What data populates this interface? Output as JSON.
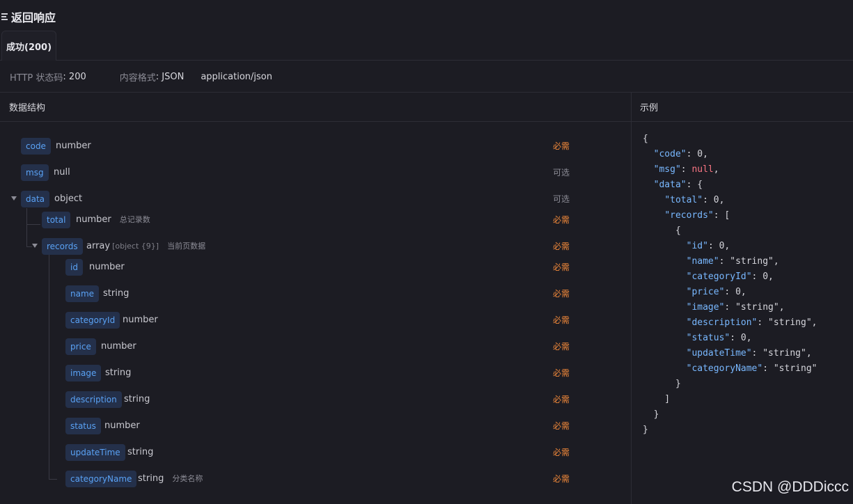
{
  "header": {
    "title": "返回响应"
  },
  "tabs": [
    {
      "label": "成功(200)"
    }
  ],
  "meta": {
    "status_label": "HTTP 状态码",
    "status_value": "200",
    "format_label": "内容格式",
    "format_value": "JSON",
    "mime": "application/json"
  },
  "schema_panel": {
    "title": "数据结构"
  },
  "example_panel": {
    "title": "示例"
  },
  "fields": {
    "code": {
      "name": "code",
      "type": "number",
      "required": "必需"
    },
    "msg": {
      "name": "msg",
      "type": "null",
      "required": "可选"
    },
    "data": {
      "name": "data",
      "type": "object",
      "required": "可选"
    },
    "total": {
      "name": "total",
      "type": "number",
      "desc": "总记录数",
      "required": "必需"
    },
    "records": {
      "name": "records",
      "type": "array",
      "subtype": "[object {9}]",
      "desc": "当前页数据",
      "required": "必需"
    },
    "id": {
      "name": "id",
      "type": "number",
      "required": "必需"
    },
    "rname": {
      "name": "name",
      "type": "string",
      "required": "必需"
    },
    "categoryId": {
      "name": "categoryId",
      "type": "number",
      "required": "必需"
    },
    "price": {
      "name": "price",
      "type": "number",
      "required": "必需"
    },
    "image": {
      "name": "image",
      "type": "string",
      "required": "必需"
    },
    "description": {
      "name": "description",
      "type": "string",
      "required": "必需"
    },
    "status": {
      "name": "status",
      "type": "number",
      "required": "必需"
    },
    "updateTime": {
      "name": "updateTime",
      "type": "string",
      "required": "必需"
    },
    "categoryName": {
      "name": "categoryName",
      "type": "string",
      "desc": "分类名称",
      "required": "必需"
    }
  },
  "example_lines": [
    "{",
    "  \"code\": 0,",
    "  \"msg\": null,",
    "  \"data\": {",
    "    \"total\": 0,",
    "    \"records\": [",
    "      {",
    "        \"id\": 0,",
    "        \"name\": \"string\",",
    "        \"categoryId\": 0,",
    "        \"price\": 0,",
    "        \"image\": \"string\",",
    "        \"description\": \"string\",",
    "        \"status\": 0,",
    "        \"updateTime\": \"string\",",
    "        \"categoryName\": \"string\"",
    "      }",
    "    ]",
    "  }",
    "}"
  ],
  "watermark": "CSDN @DDDiccc",
  "colors": {
    "required": "#f0883a",
    "tag_text": "#5aa2f5",
    "tag_bg": "#24304a",
    "json_key": "#79b8ff",
    "json_null": "#f97583"
  }
}
